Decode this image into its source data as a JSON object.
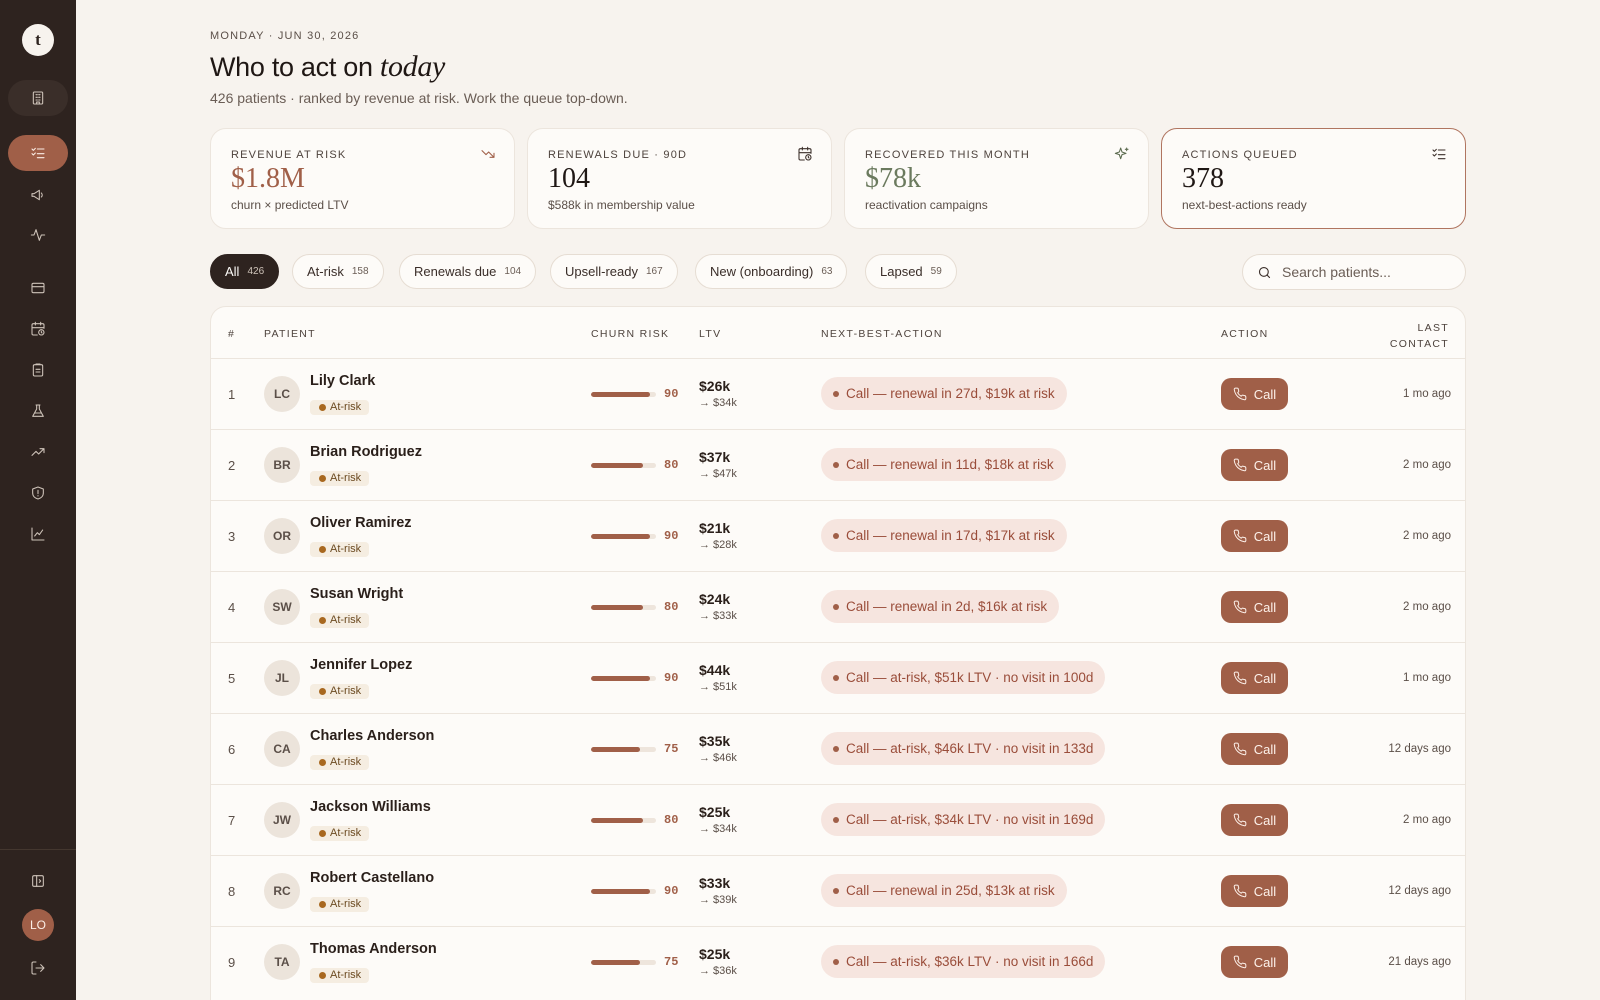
{
  "sidebar": {
    "logo_letter": "t",
    "nav": [
      {
        "icon": "building-icon",
        "state": "muted"
      },
      {
        "icon": "list-checks-icon",
        "state": "active"
      },
      {
        "icon": "megaphone-icon",
        "state": "normal"
      },
      {
        "icon": "activity-icon",
        "state": "normal"
      },
      {
        "icon": "credit-card-icon",
        "state": "normal"
      },
      {
        "icon": "calendar-clock-icon",
        "state": "normal"
      },
      {
        "icon": "clipboard-icon",
        "state": "normal"
      },
      {
        "icon": "flask-icon",
        "state": "normal"
      },
      {
        "icon": "trending-up-icon",
        "state": "normal"
      },
      {
        "icon": "shield-alert-icon",
        "state": "normal"
      },
      {
        "icon": "line-chart-icon",
        "state": "normal"
      }
    ],
    "footer": {
      "toggle_icon": "panel-left-icon",
      "avatar_initials": "LO",
      "logout_icon": "log-out-icon"
    }
  },
  "header": {
    "date_eyebrow": "MONDAY · JUN 30, 2026",
    "title_prefix": "Who to act on",
    "title_emphasis": "today",
    "subtitle": "426 patients · ranked by revenue at risk. Work the queue top-down."
  },
  "kpis": [
    {
      "label": "REVENUE AT RISK",
      "value": "$1.8M",
      "sub": "churn × predicted LTV",
      "icon": "trending-down-icon",
      "color": "#a05f48",
      "highlight": false
    },
    {
      "label": "RENEWALS DUE · 90D",
      "value": "104",
      "sub": "$588k in membership value",
      "icon": "calendar-clock-icon",
      "color": "#1f1714",
      "highlight": false
    },
    {
      "label": "RECOVERED THIS MONTH",
      "value": "$78k",
      "sub": "reactivation campaigns",
      "icon": "sparkles-icon",
      "color": "#6b7a5e",
      "highlight": false
    },
    {
      "label": "ACTIONS QUEUED",
      "value": "378",
      "sub": "next-best-actions ready",
      "icon": "list-checks-icon",
      "color": "#1f1714",
      "highlight": true
    }
  ],
  "filters": [
    {
      "label": "All",
      "count": "426",
      "active": true
    },
    {
      "label": "At-risk",
      "count": "158",
      "active": false
    },
    {
      "label": "Renewals due",
      "count": "104",
      "active": false
    },
    {
      "label": "Upsell-ready",
      "count": "167",
      "active": false
    },
    {
      "label": "New (onboarding)",
      "count": "63",
      "active": false
    },
    {
      "label": "Lapsed",
      "count": "59",
      "active": false
    }
  ],
  "search": {
    "placeholder": "Search patients..."
  },
  "table": {
    "headers": {
      "num": "#",
      "patient": "PATIENT",
      "churn_risk": "CHURN RISK",
      "ltv": "LTV",
      "nba": "NEXT-BEST-ACTION",
      "action": "ACTION",
      "last_line1": "LAST",
      "last_line2": "CONTACT"
    },
    "rows": [
      {
        "rank": "1",
        "initials": "LC",
        "name": "Lily Clark",
        "status": "At-risk",
        "risk": 90,
        "risk_label": "90",
        "ltv": "$26k",
        "proj": "→ $34k",
        "nba": "Call — renewal in 27d, $19k at risk",
        "action": "Call",
        "last_contact": "1 mo ago"
      },
      {
        "rank": "2",
        "initials": "BR",
        "name": "Brian Rodriguez",
        "status": "At-risk",
        "risk": 80,
        "risk_label": "80",
        "ltv": "$37k",
        "proj": "→ $47k",
        "nba": "Call — renewal in 11d, $18k at risk",
        "action": "Call",
        "last_contact": "2 mo ago"
      },
      {
        "rank": "3",
        "initials": "OR",
        "name": "Oliver Ramirez",
        "status": "At-risk",
        "risk": 90,
        "risk_label": "90",
        "ltv": "$21k",
        "proj": "→ $28k",
        "nba": "Call — renewal in 17d, $17k at risk",
        "action": "Call",
        "last_contact": "2 mo ago"
      },
      {
        "rank": "4",
        "initials": "SW",
        "name": "Susan Wright",
        "status": "At-risk",
        "risk": 80,
        "risk_label": "80",
        "ltv": "$24k",
        "proj": "→ $33k",
        "nba": "Call — renewal in 2d, $16k at risk",
        "action": "Call",
        "last_contact": "2 mo ago"
      },
      {
        "rank": "5",
        "initials": "JL",
        "name": "Jennifer Lopez",
        "status": "At-risk",
        "risk": 90,
        "risk_label": "90",
        "ltv": "$44k",
        "proj": "→ $51k",
        "nba": "Call — at-risk, $51k LTV · no visit in 100d",
        "action": "Call",
        "last_contact": "1 mo ago"
      },
      {
        "rank": "6",
        "initials": "CA",
        "name": "Charles Anderson",
        "status": "At-risk",
        "risk": 75,
        "risk_label": "75",
        "ltv": "$35k",
        "proj": "→ $46k",
        "nba": "Call — at-risk, $46k LTV · no visit in 133d",
        "action": "Call",
        "last_contact": "12 days ago"
      },
      {
        "rank": "7",
        "initials": "JW",
        "name": "Jackson Williams",
        "status": "At-risk",
        "risk": 80,
        "risk_label": "80",
        "ltv": "$25k",
        "proj": "→ $34k",
        "nba": "Call — at-risk, $34k LTV · no visit in 169d",
        "action": "Call",
        "last_contact": "2 mo ago"
      },
      {
        "rank": "8",
        "initials": "RC",
        "name": "Robert Castellano",
        "status": "At-risk",
        "risk": 90,
        "risk_label": "90",
        "ltv": "$33k",
        "proj": "→ $39k",
        "nba": "Call — renewal in 25d, $13k at risk",
        "action": "Call",
        "last_contact": "12 days ago"
      },
      {
        "rank": "9",
        "initials": "TA",
        "name": "Thomas Anderson",
        "status": "At-risk",
        "risk": 75,
        "risk_label": "75",
        "ltv": "$25k",
        "proj": "→ $36k",
        "nba": "Call — at-risk, $36k LTV · no visit in 166d",
        "action": "Call",
        "last_contact": "21 days ago"
      }
    ]
  }
}
